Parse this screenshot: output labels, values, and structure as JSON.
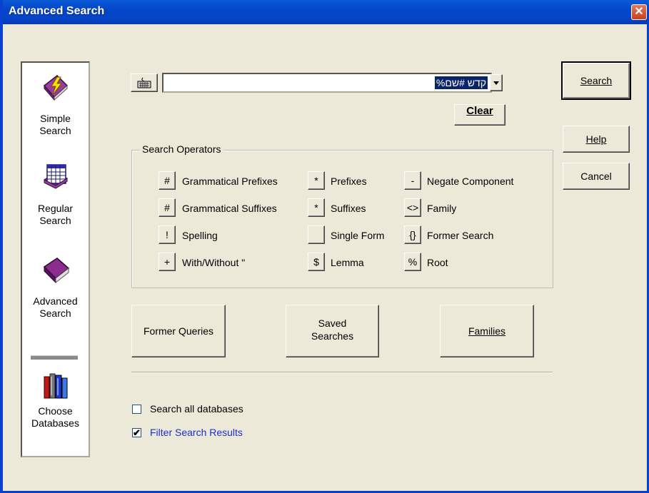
{
  "window": {
    "title": "Advanced Search",
    "close_glyph": "✕"
  },
  "sidebar": {
    "items": [
      {
        "line1": "Simple",
        "line2": "Search",
        "icon": "lightning-book-icon"
      },
      {
        "line1": "Regular",
        "line2": "Search",
        "icon": "grid-book-icon"
      },
      {
        "line1": "Advanced",
        "line2": "Search",
        "icon": "purple-book-icon"
      },
      {
        "line1": "Choose",
        "line2": "Databases",
        "icon": "books-icon"
      }
    ]
  },
  "search": {
    "query_value": "%קדש #שם",
    "clear_label": "Clear"
  },
  "right_buttons": {
    "search_label": "Search",
    "help_label": "Help",
    "cancel_label": "Cancel"
  },
  "operators": {
    "group_title": "Search Operators",
    "items": [
      {
        "symbol": "#",
        "label": "Grammatical Prefixes"
      },
      {
        "symbol": "#",
        "label": "Grammatical Suffixes"
      },
      {
        "symbol": "!",
        "label": "Spelling"
      },
      {
        "symbol": "+",
        "label": "With/Without \""
      },
      {
        "symbol": "*",
        "label": "Prefixes"
      },
      {
        "symbol": "*",
        "label": "Suffixes"
      },
      {
        "symbol": "",
        "label": "Single Form"
      },
      {
        "symbol": "$",
        "label": "Lemma"
      },
      {
        "symbol": "-",
        "label": "Negate Component"
      },
      {
        "symbol": "<>",
        "label": "Family"
      },
      {
        "symbol": "{}",
        "label": "Former Search"
      },
      {
        "symbol": "%",
        "label": "Root"
      }
    ]
  },
  "actions": {
    "former_queries": "Former Queries",
    "saved_line1": "Saved",
    "saved_line2": "Searches",
    "families": "Families"
  },
  "options": {
    "search_all_label": "Search all databases",
    "search_all_checked": false,
    "filter_label": "Filter Search Results",
    "filter_checked": true,
    "check_glyph": "✔",
    "filter_color": "#1a2fd0"
  }
}
